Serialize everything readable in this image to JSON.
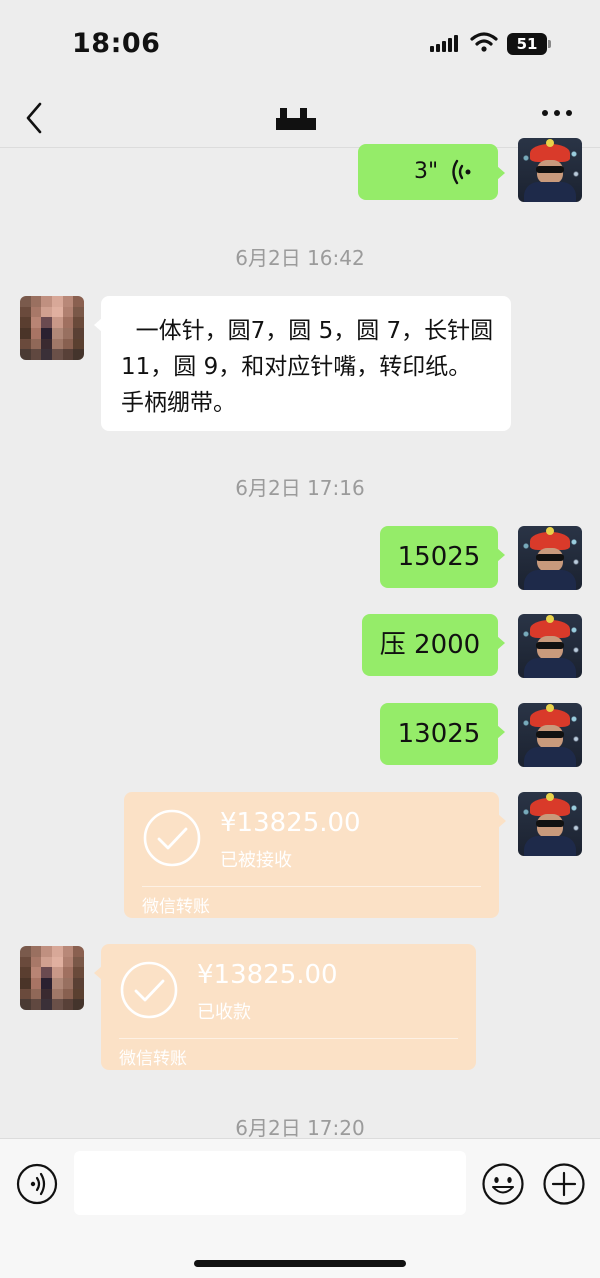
{
  "status_bar": {
    "time": "18:06",
    "battery": "51"
  },
  "nav": {
    "title_mark": "obscured"
  },
  "messages": {
    "voice": {
      "duration": "3\""
    },
    "ts1": "6月2日 16:42",
    "text1": "  一体针，圆7，圆 5，圆 7，长针圆 11，圆 9，和对应针嘴，转印纸。 手柄绷带。",
    "ts2": "6月2日 17:16",
    "m1": "15025",
    "m2": "压 2000",
    "m3": "13025",
    "transfer_sent": {
      "amount": "¥13825.00",
      "status": "已被接收",
      "label": "微信转账"
    },
    "transfer_received": {
      "amount": "¥13825.00",
      "status": "已收款",
      "label": "微信转账"
    },
    "ts3": "6月2日 17:20"
  },
  "input": {
    "placeholder": ""
  },
  "colors": {
    "self_bubble": "#95ec69",
    "other_bubble": "#ffffff",
    "transfer_card": "#fbe1c6",
    "background": "#ededed"
  },
  "icons": [
    "back-icon",
    "more-icon",
    "voice-waves-icon",
    "check-icon",
    "voice-toggle-icon",
    "emoji-icon",
    "plus-icon",
    "signal-icon",
    "wifi-icon",
    "battery-icon"
  ]
}
